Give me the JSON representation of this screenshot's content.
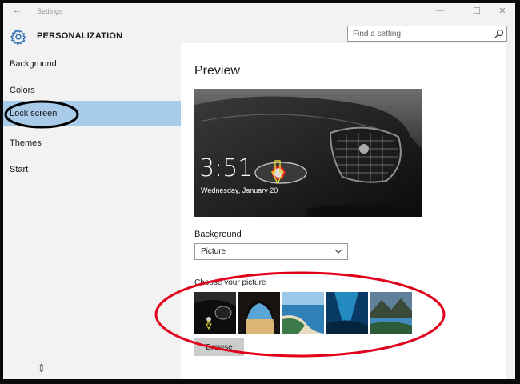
{
  "window": {
    "title": "Settings",
    "back_glyph": "←",
    "min_glyph": "—",
    "max_glyph": "☐",
    "close_glyph": "✕"
  },
  "header": {
    "app_title": "PERSONALIZATION",
    "search_placeholder": "Find a setting"
  },
  "sidebar": {
    "items": [
      {
        "label": "Background",
        "active": false
      },
      {
        "label": "Colors",
        "active": false
      },
      {
        "label": "Lock screen",
        "active": true
      },
      {
        "label": "Themes",
        "active": false
      },
      {
        "label": "Start",
        "active": false
      }
    ],
    "resize_glyph": "⇕"
  },
  "main": {
    "preview_title": "Preview",
    "preview": {
      "time": "3:51",
      "date": "Wednesday, January 20"
    },
    "background_label": "Background",
    "background_value": "Picture",
    "choose_label": "Choose your picture",
    "thumbnails": [
      "car",
      "cave-beach",
      "aerial-coast",
      "underwater-ice",
      "lake-mountains"
    ],
    "browse_label": "Browse"
  },
  "colors": {
    "accent": "#a9cbea",
    "gear": "#2d6db5",
    "annotation": "#e0001a"
  }
}
